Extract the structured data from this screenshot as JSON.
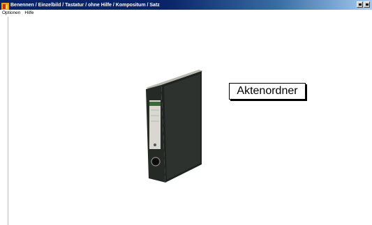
{
  "window": {
    "title": "Benennen / Einzelbild / Tastatur / ohne Hilfe / Kompositum / Satz"
  },
  "menu": {
    "items": [
      {
        "label": "Optionen"
      },
      {
        "label": "Hilfe"
      }
    ]
  },
  "content": {
    "image_subject": "binder-icon",
    "word": "Aktenordner"
  },
  "colors": {
    "titlebar_start": "#0a246a",
    "titlebar_end": "#a6caf0",
    "binder_cover": "#2b2f2c",
    "binder_label": "#d8d8d0"
  }
}
